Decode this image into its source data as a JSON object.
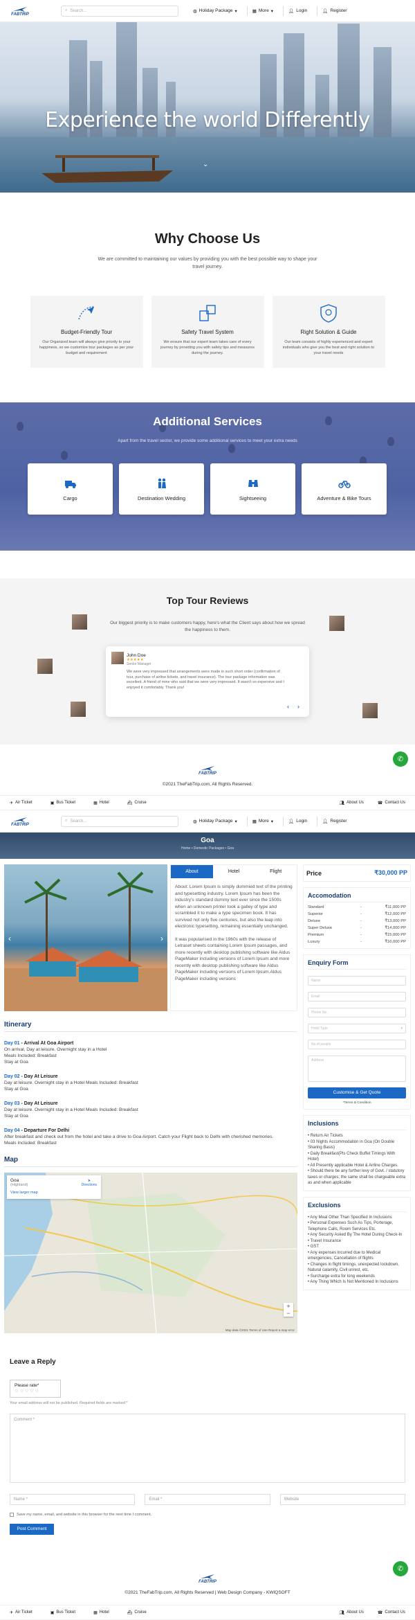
{
  "brand": {
    "logo_text": "FABTRIP",
    "accent": "#1b69c5",
    "dark_accent": "#1a3c6d"
  },
  "header": {
    "search_placeholder": "Search...",
    "holiday_package": "Holiday Package",
    "more": "More",
    "login": "Login",
    "register": "Register"
  },
  "hero": {
    "title": "Experience the world Differently"
  },
  "why": {
    "title": "Why Choose Us",
    "subtitle": "We are committed to maintaining our values by providing you with the best possible way to shape your travel journey.",
    "cards": [
      {
        "title": "Budget-Friendly Tour",
        "desc": "Our Organized team will always give priority to your happiness, so we customize tour packages as per your budget and requirement",
        "icon": "plane-route-icon"
      },
      {
        "title": "Safety Travel System",
        "desc": "We ensure that our expert team takes care of every journey by providing you with safety tips and measures during the journey.",
        "icon": "safety-system-icon"
      },
      {
        "title": "Right Solution & Guide",
        "desc": "Our team consists of highly experienced and expert individuals who give you the best and right solution to your travel needs",
        "icon": "shield-guide-icon"
      }
    ]
  },
  "services": {
    "title": "Additional Services",
    "subtitle": "Apart from the travel sector, we provide some additional services to meet your extra needs",
    "cards": [
      {
        "label": "Cargo",
        "icon": "truck-icon"
      },
      {
        "label": "Destination Wedding",
        "icon": "couple-icon"
      },
      {
        "label": "Sightseeing",
        "icon": "binoculars-icon"
      },
      {
        "label": "Adventure & Bike Tours",
        "icon": "bike-icon"
      }
    ]
  },
  "reviews": {
    "title": "Top Tour Reviews",
    "subtitle": "Our biggest priority is to make customers happy, here's what the Client says about how we spread the happiness to them.",
    "name": "John Doe",
    "stars": "★★★★★",
    "role": "Senior Manager",
    "text": "We were very impressed that arrangements were made in such short order (confirmation of tour, purchase of airline tickets, and travel insurance). The tour package information was excellent. A friend of mine who said that we were very impressed. It wasn't so expensive and I enjoyed it comfortably. Thank you!"
  },
  "footer": {
    "copyright1": "©2021 TheFabTrip.com, All Rights Reserved.",
    "copyright2": "©2021 TheFabTrip.com, All Rights Reserved | Web Design Company - KWIQSOFT"
  },
  "bottom_nav": {
    "air": "Air Ticket",
    "bus": "Bus Ticket",
    "hotel": "Hotel",
    "cruise": "Cruise",
    "about": "About Us",
    "contact": "Contact Us"
  },
  "tour": {
    "title": "Goa",
    "breadcrumb": "Home • Domestic Packages • Goa",
    "tabs": [
      "About",
      "Hotel",
      "Flight"
    ],
    "about_p1": "About: Lorem Ipsum is simply dummied text of the printing and typesetting industry. Lorem Ipsum has been the industry's standard dummy text ever since the 1500s when an unknown printer took a galley of type and scrambled it to make a type specimen book. It has survived not only five centuries, but also the leap into electronic typesetting, remaining essentially unchanged.",
    "about_p2": "It was popularised in the 1960s with the release of Letraset sheets containing Lorem Ipsum passages, and more recently with desktop publishing software like Aldus PageMaker including versions of Lorem Ipsum and more recently with desktop publishing software like Aldus PageMaker including versions of Lorem Ipsum.Aldus PageMaker including versions",
    "itinerary_title": "Itinerary",
    "days": [
      {
        "num": "Day 01",
        "title": " - Arrival At Goa Airport",
        "lines": [
          "On arrival, Day at leisure. Overnight stay in a Hotel",
          "Meals Included: Breakfast",
          "Stay at Goa"
        ]
      },
      {
        "num": "Day 02",
        "title": " - Day At Leisure",
        "lines": [
          "Day at leisure. Overnight stay in a Hotel Meals Included: Breakfast",
          "Stay at Goa"
        ]
      },
      {
        "num": "Day 03",
        "title": " - Day At Leisure",
        "lines": [
          "Day at leisure. Overnight stay in a Hotel Meals Included: Breakfast",
          "Stay at Goa"
        ]
      },
      {
        "num": "Day 04",
        "title": " - Departure For Delhi",
        "lines": [
          "After breakfast and check out from the hotel and take a drive to Goa Airport. Catch your Flight back to Delhi with cherished memories.",
          "Meals Included: Breakfast"
        ]
      }
    ],
    "map_title": "Map",
    "map": {
      "place": "Goa",
      "region": "(Highland)",
      "directions": "Directions",
      "larger": "View larger map",
      "footer": "Map data ©2021  Terms of Use  Report a map error",
      "zoom_in": "+",
      "zoom_out": "−"
    },
    "price_label": "Price",
    "price_value": "₹30,000 PP",
    "accommodation_title": "Accomodation",
    "accommodation": [
      {
        "name": "Standard",
        "price": "₹11,000 PP"
      },
      {
        "name": "Superior",
        "price": "₹12,000 PP"
      },
      {
        "name": "Deluxe",
        "price": "₹13,000 PP"
      },
      {
        "name": "Super Deluxe",
        "price": "₹14,000 PP"
      },
      {
        "name": "Premium",
        "price": "₹15,000 PP"
      },
      {
        "name": "Luxury",
        "price": "₹16,000 PP"
      }
    ],
    "enquiry_title": "Enquiry Form",
    "enquiry_fields": [
      "Name",
      "Email",
      "Phone No.",
      "Hotel Type",
      "No.of people",
      "Address"
    ],
    "quote_button": "Customise & Get Quote",
    "terms": "*Terms & Condition",
    "inclusions_title": "Inclusions",
    "inclusions": [
      "• Return Air Tickets",
      "• 03 Nights Accommodation in Goa (On Double Sharing Basis)",
      "• Daily Breakfast(Pls Check Buffet Timings With Hotel)",
      "• All Presently applicable Hotel & Airline Charges.",
      "• Should there be any further levy of Govt. / statutory taxes or charges; the same shall be chargeable extra as and when applicable"
    ],
    "exclusions_title": "Exclusions",
    "exclusions": [
      "• Any Meal Other Than Specified In Inclusions",
      "• Personal Expenses Such As Tips, Porterage, Telephone Calls, Room Services Etc.",
      "• Any Security Asked By The Hotel During Check-In",
      "• Travel Insurance",
      "• GST",
      "• Any expenses incurred due to Medical emergencies, Cancellation of flights",
      "• Changes in flight timings, unexpected lockdown, Natural calamity, Civil unrest, etc.",
      "• Surcharge extra for long weekends",
      "• Any Thing Which Is Not Mentioned In Inclusions"
    ]
  },
  "reply": {
    "title": "Leave a Reply",
    "rate_label": "Please rate*",
    "rate_stars": "☆☆☆☆☆",
    "note": "Your email address will not be published. Required fields are marked *",
    "comment_ph": "Comment *",
    "name_ph": "Name *",
    "email_ph": "Email *",
    "website_ph": "Website",
    "save_label": "Save my name, email, and website in this browser for the next time I comment.",
    "post_button": "Post Comment"
  }
}
